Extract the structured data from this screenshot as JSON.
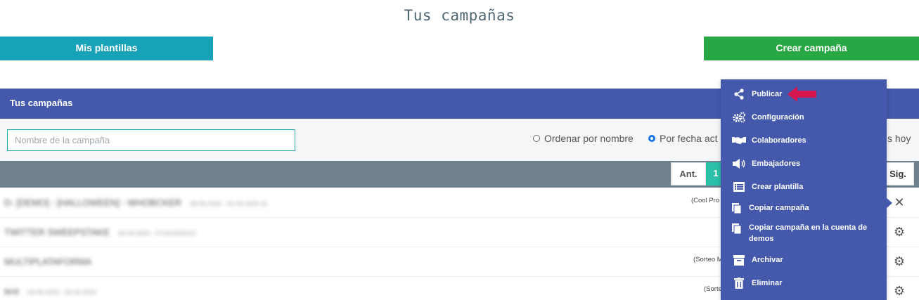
{
  "page": {
    "title": "Tus campañas"
  },
  "buttons": {
    "templates": "Mis plantillas",
    "create": "Crear campaña"
  },
  "panel": {
    "title": "Tus campañas"
  },
  "filters": {
    "search_placeholder": "Nombre de la campaña",
    "sort_by_name": "Ordenar por nombre",
    "sort_by_date": "Por fecha act",
    "hoy_partial": "s hoy",
    "selected_sort": "Por fecha act"
  },
  "pagination": {
    "prev": "Ant.",
    "current": "1",
    "next": "Sig."
  },
  "rows": [
    {
      "name": "D- [DEMO] - [HALLOWEEN] - WHOBCKER",
      "meta": "08.09.2020 - 01.09.2020 22",
      "tag": "(Cool Pro",
      "action": "✕"
    },
    {
      "name": "TWITTER SWEEPSTAKE",
      "meta": "25.09.2020 - 07/10/2020/22",
      "tag": "",
      "action": "⚙"
    },
    {
      "name": "MULTIPLATAFORMA",
      "meta": "",
      "tag": "(Sorteo M",
      "action": "⚙"
    },
    {
      "name": "test",
      "meta": "09.09.2020 - 09.09.2020",
      "tag": "(Sorte",
      "action": "⚙"
    }
  ],
  "menu": {
    "items": [
      {
        "icon": "share-icon",
        "label": "Publicar"
      },
      {
        "icon": "cogs-icon",
        "label": "Configuración"
      },
      {
        "icon": "handshake-icon",
        "label": "Colaboradores"
      },
      {
        "icon": "megaphone-icon",
        "label": "Embajadores"
      },
      {
        "icon": "list-icon",
        "label": "Crear plantilla"
      },
      {
        "icon": "copy-icon",
        "label": "Copiar campaña"
      },
      {
        "icon": "copy-icon",
        "label": "Copiar campaña en la cuenta de demos"
      },
      {
        "icon": "archive-icon",
        "label": "Archivar"
      },
      {
        "icon": "trash-icon",
        "label": "Eliminar"
      }
    ]
  },
  "colors": {
    "primary_blue": "#4459ac",
    "teal": "#17a2b8",
    "green": "#28a745",
    "pager_bar": "#6f818c",
    "active_page": "#2bc0a7",
    "annotation_arrow": "#d6174f"
  }
}
